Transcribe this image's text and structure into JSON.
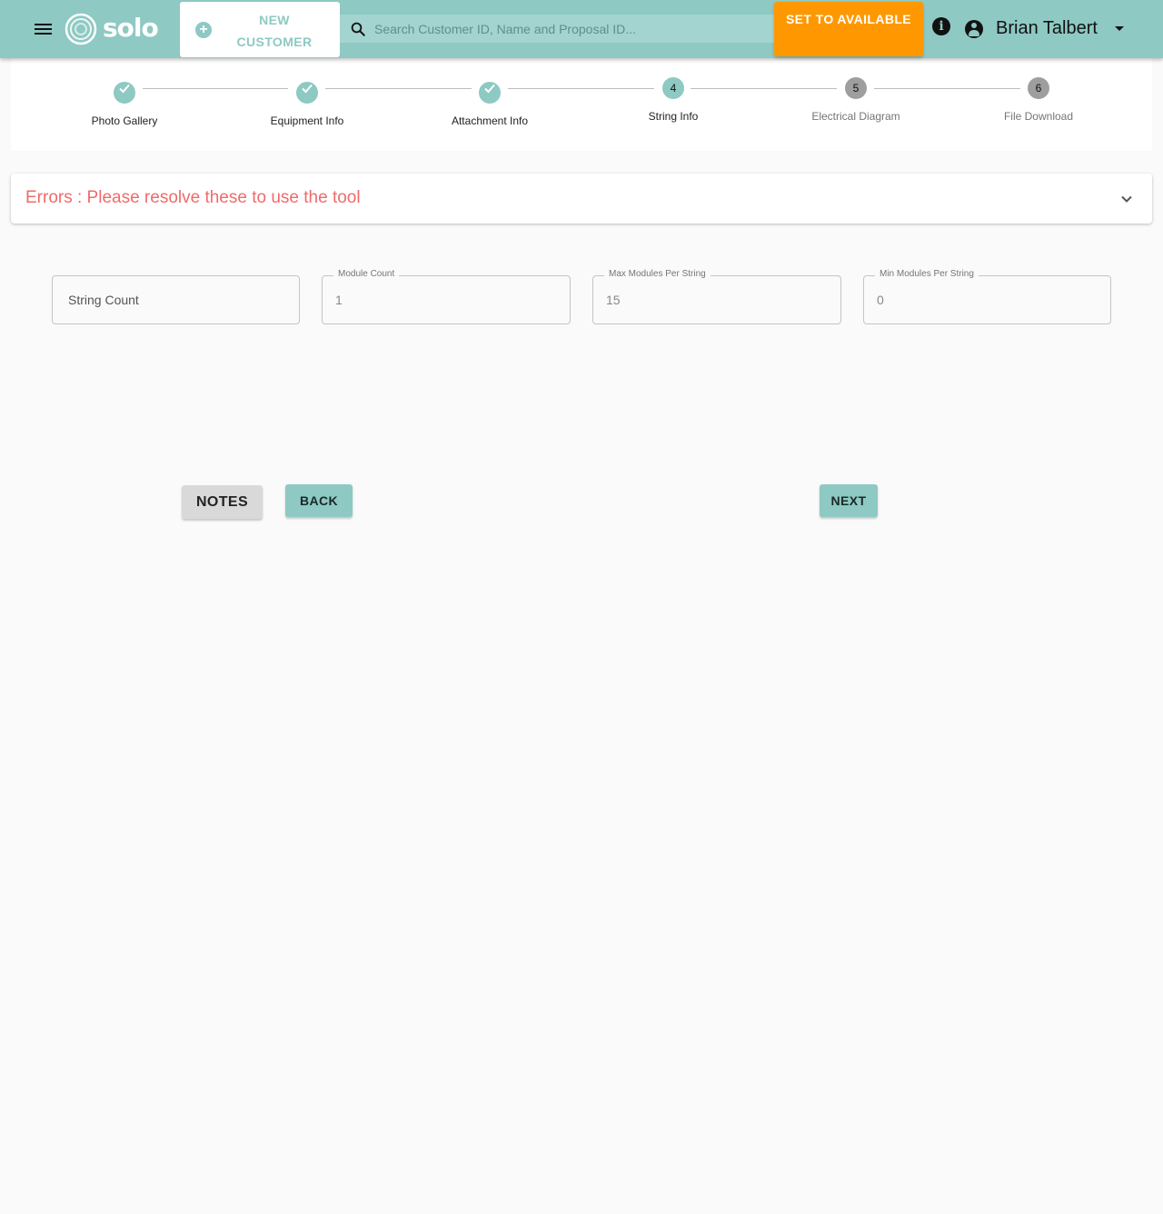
{
  "header": {
    "brand": "solo",
    "new_customer_label": "NEW CUSTOMER",
    "search_placeholder": "Search Customer ID, Name and Proposal ID...",
    "set_available_label": "SET TO AVAILABLE",
    "user_name": "Brian Talbert",
    "colors": {
      "bar": "#8ec9c3",
      "accent": "#ff9800"
    }
  },
  "stepper": {
    "steps": [
      {
        "number": "1",
        "label": "Photo Gallery",
        "state": "complete"
      },
      {
        "number": "2",
        "label": "Equipment Info",
        "state": "complete"
      },
      {
        "number": "3",
        "label": "Attachment Info",
        "state": "complete"
      },
      {
        "number": "4",
        "label": "String Info",
        "state": "active"
      },
      {
        "number": "5",
        "label": "Electrical Diagram",
        "state": "pending"
      },
      {
        "number": "6",
        "label": "File Download",
        "state": "pending"
      }
    ]
  },
  "errors": {
    "title": "Errors : Please resolve these to use the tool",
    "color": "#ef6b6b"
  },
  "form": {
    "string_count": {
      "placeholder": "String Count",
      "value": ""
    },
    "module_count": {
      "label": "Module Count",
      "value": "1"
    },
    "max_modules": {
      "label": "Max Modules Per String",
      "value": "15"
    },
    "min_modules": {
      "label": "Min Modules Per String",
      "value": "0"
    }
  },
  "actions": {
    "notes_label": "NOTES",
    "back_label": "BACK",
    "next_label": "NEXT"
  }
}
